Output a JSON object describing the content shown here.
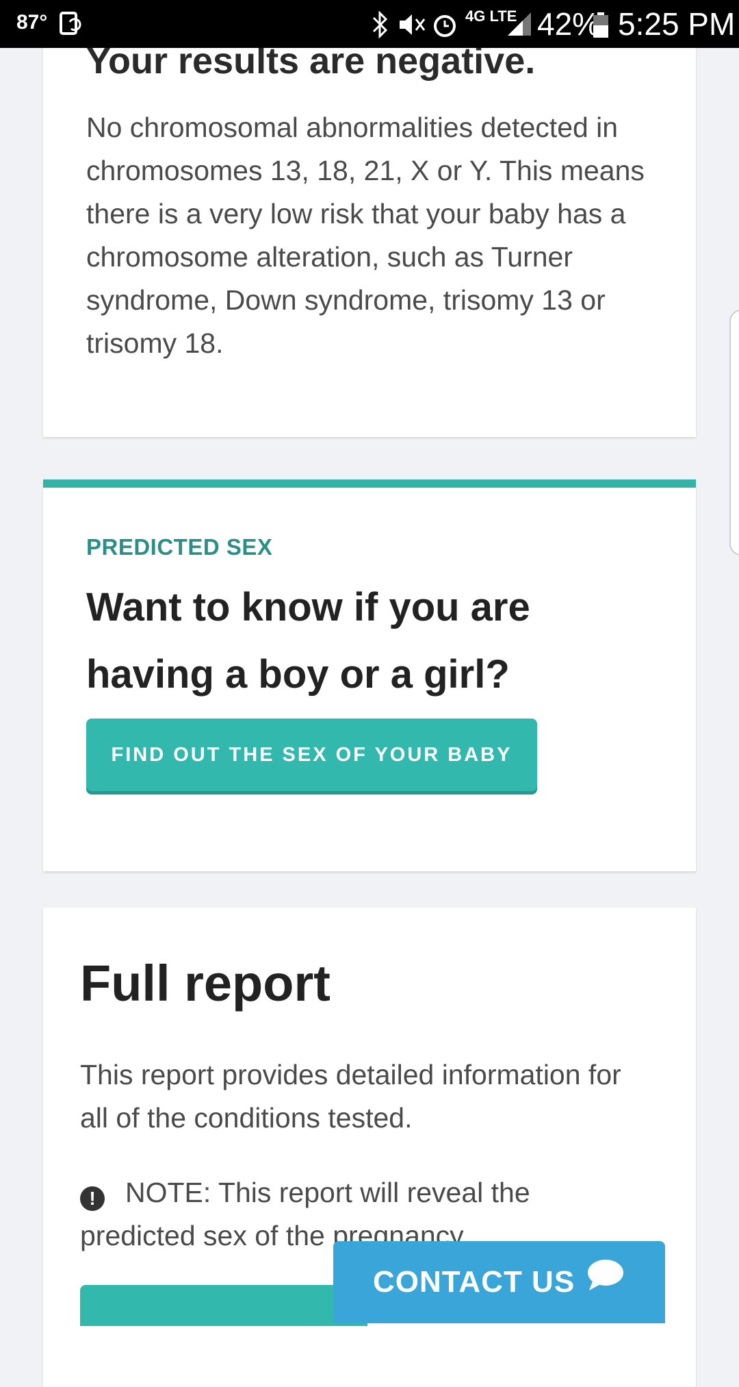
{
  "status_bar": {
    "temperature": "87°",
    "battery_percent": "42%",
    "time": "5:25 PM",
    "network": "4G LTE",
    "icons": [
      "screenshot-icon",
      "bluetooth-icon",
      "mute-icon",
      "alarm-icon",
      "signal-icon",
      "battery-icon"
    ]
  },
  "results_card": {
    "heading": "Your results are negative.",
    "body": "No chromosomal abnormalities detected in chromosomes 13, 18, 21, X or Y. This means there is a very low risk that your baby has a chromosome alteration, such as Turner syndrome, Down syndrome, trisomy 13 or trisomy 18."
  },
  "sex_card": {
    "eyebrow": "PREDICTED SEX",
    "question": "Want to know if you are having a boy or a girl?",
    "button_label": "FIND OUT THE SEX OF YOUR BABY"
  },
  "report_card": {
    "title": "Full report",
    "description": "This report provides detailed information for all of the conditions tested.",
    "note": "NOTE: This report will reveal the predicted sex of the pregnancy."
  },
  "contact": {
    "label": "CONTACT US"
  },
  "colors": {
    "accent_teal": "#32b8ac",
    "contact_blue": "#3aa5d8",
    "background": "#f0f2f5"
  }
}
